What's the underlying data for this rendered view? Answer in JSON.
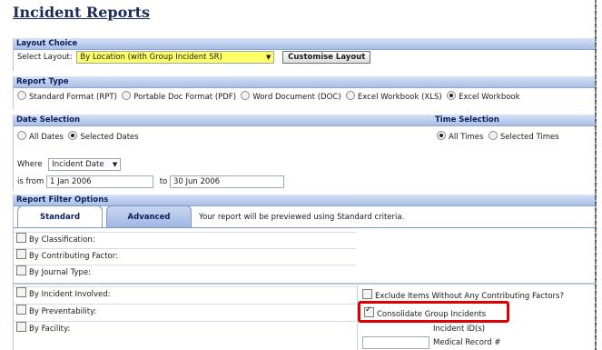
{
  "page": {
    "title": "Incident Reports"
  },
  "layout_choice": {
    "header": "Layout Choice",
    "label": "Select Layout:",
    "selected": "By Location (with Group Incident SR)",
    "button": "Customise Layout"
  },
  "report_type": {
    "header": "Report Type",
    "options": [
      {
        "label": "Standard Format (RPT)",
        "selected": false
      },
      {
        "label": "Portable Doc Format (PDF)",
        "selected": false
      },
      {
        "label": "Word Document (DOC)",
        "selected": false
      },
      {
        "label": "Excel Workbook (XLS)",
        "selected": false
      },
      {
        "label": "Excel Workbook",
        "selected": true
      }
    ]
  },
  "date_selection": {
    "header": "Date Selection",
    "time_header": "Time Selection",
    "all_dates": "All Dates",
    "selected_dates": "Selected Dates",
    "all_times": "All Times",
    "selected_times": "Selected Times",
    "where_label": "Where",
    "where_value": "Incident Date",
    "from_label": "is from",
    "from_value": "1 Jan 2006",
    "to_label": "to",
    "to_value": "30 Jun 2006"
  },
  "filter_options": {
    "header": "Report Filter Options",
    "tabs": [
      "Standard",
      "Advanced"
    ],
    "active_tab": "Standard",
    "preview_note": "Your report will be previewed using Standard criteria.",
    "left_items": [
      "By Classification:",
      "By Contributing Factor:",
      "By Journal Type:",
      "By Incident Involved:",
      "By Preventability:",
      "By Facility:"
    ],
    "exclude_label": "Exclude Items Without Any Contributing Factors?",
    "consolidate_label": "Consolidate Group Incidents",
    "consolidate_checked": true,
    "incident_id_label": "Incident ID(s)",
    "medical_record_label": "Medical Record #"
  },
  "colors": {
    "header_text": "#0a1f5c",
    "highlight": "#ffff66",
    "callout": "#e00000"
  }
}
